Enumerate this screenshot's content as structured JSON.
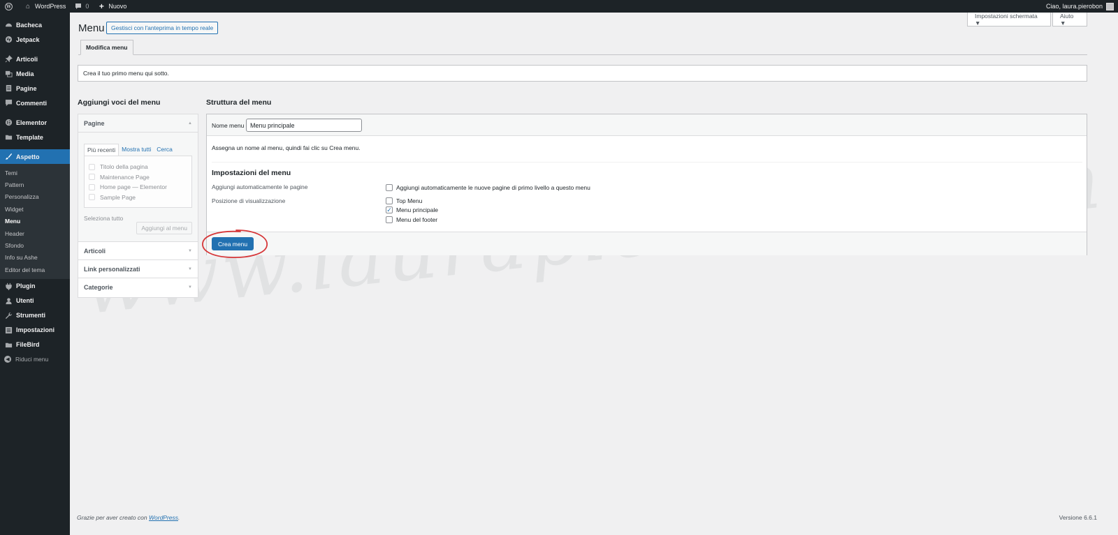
{
  "adminbar": {
    "site_name": "WordPress",
    "comments_count": "0",
    "new_label": "Nuovo",
    "greeting": "Ciao, laura.pierobon"
  },
  "sidebar": {
    "items_top": [
      {
        "label": "Bacheca",
        "icon": "dashboard-icon"
      },
      {
        "label": "Jetpack",
        "icon": "jetpack-icon"
      }
    ],
    "items_content": [
      {
        "label": "Articoli",
        "icon": "pin-icon"
      },
      {
        "label": "Media",
        "icon": "media-icon"
      },
      {
        "label": "Pagine",
        "icon": "page-icon"
      },
      {
        "label": "Commenti",
        "icon": "comment-icon"
      }
    ],
    "items_builder": [
      {
        "label": "Elementor",
        "icon": "elementor-icon"
      },
      {
        "label": "Template",
        "icon": "folder-icon"
      }
    ],
    "active_item": {
      "label": "Aspetto",
      "icon": "brush-icon"
    },
    "submenu": [
      "Temi",
      "Pattern",
      "Personalizza",
      "Widget",
      "Menu",
      "Header",
      "Sfondo",
      "Info su Ashe",
      "Editor del tema"
    ],
    "submenu_current": "Menu",
    "items_bottom": [
      {
        "label": "Plugin",
        "icon": "plugin-icon"
      },
      {
        "label": "Utenti",
        "icon": "users-icon"
      },
      {
        "label": "Strumenti",
        "icon": "tools-icon"
      },
      {
        "label": "Impostazioni",
        "icon": "settings-icon"
      },
      {
        "label": "FileBird",
        "icon": "filebird-icon"
      }
    ],
    "collapse_label": "Riduci menu"
  },
  "screen_options": {
    "label": "Impostazioni schermata ▼",
    "help": "Aiuto ▼"
  },
  "header": {
    "title": "Menu",
    "live_preview": "Gestisci con l'anteprima in tempo reale",
    "tab": "Modifica menu"
  },
  "notice": "Crea il tuo primo menu qui sotto.",
  "left": {
    "title": "Aggiungi voci del menu",
    "pages": {
      "heading": "Pagine",
      "tabs": [
        "Più recenti",
        "Mostra tutti",
        "Cerca"
      ],
      "items": [
        "Titolo della pagina",
        "Maintenance Page",
        "Home page — Elementor",
        "Sample Page"
      ],
      "select_all": "Seleziona tutto",
      "add_button": "Aggiungi al menu"
    },
    "sections": [
      "Articoli",
      "Link personalizzati",
      "Categorie"
    ]
  },
  "right": {
    "title": "Struttura del menu",
    "name_label": "Nome menu",
    "name_value": "Menu principale",
    "assign_text": "Assegna un nome al menu, quindi fai clic su Crea menu.",
    "settings_title": "Impostazioni del menu",
    "auto_add_label": "Aggiungi automaticamente le pagine",
    "auto_add_option": "Aggiungi automaticamente le nuove pagine di primo livello a questo menu",
    "auto_add_checked": false,
    "location_label": "Posizione di visualizzazione",
    "locations": [
      {
        "label": "Top Menu",
        "checked": false
      },
      {
        "label": "Menu principale",
        "checked": true
      },
      {
        "label": "Menu del footer",
        "checked": false
      }
    ],
    "create_button": "Crea menu"
  },
  "watermark": "www.laurapierobon.com",
  "footer": {
    "thanks_prefix": "Grazie per aver creato con ",
    "thanks_link": "WordPress",
    "thanks_suffix": ".",
    "version": "Versione 6.6.1"
  },
  "colors": {
    "primary": "#2271b1",
    "sidebar": "#1d2327",
    "background": "#f0f0f1",
    "highlight": "#d63638"
  }
}
